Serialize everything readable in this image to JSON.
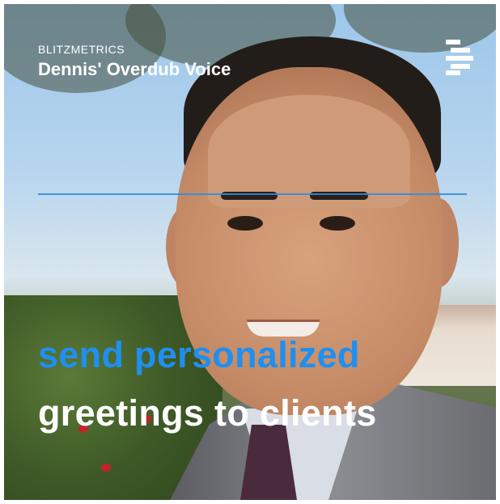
{
  "overlay": {
    "brand": "BLITZMETRICS",
    "title": "Dennis' Overdub Voice",
    "logo_icon": "descript-logo-icon"
  },
  "caption": {
    "line1": "send personalized",
    "line2": "greetings to clients"
  },
  "colors": {
    "caption_highlight": "#1f8ff0",
    "caption_text": "#ffffff",
    "scanline": "#2f8ce0"
  }
}
